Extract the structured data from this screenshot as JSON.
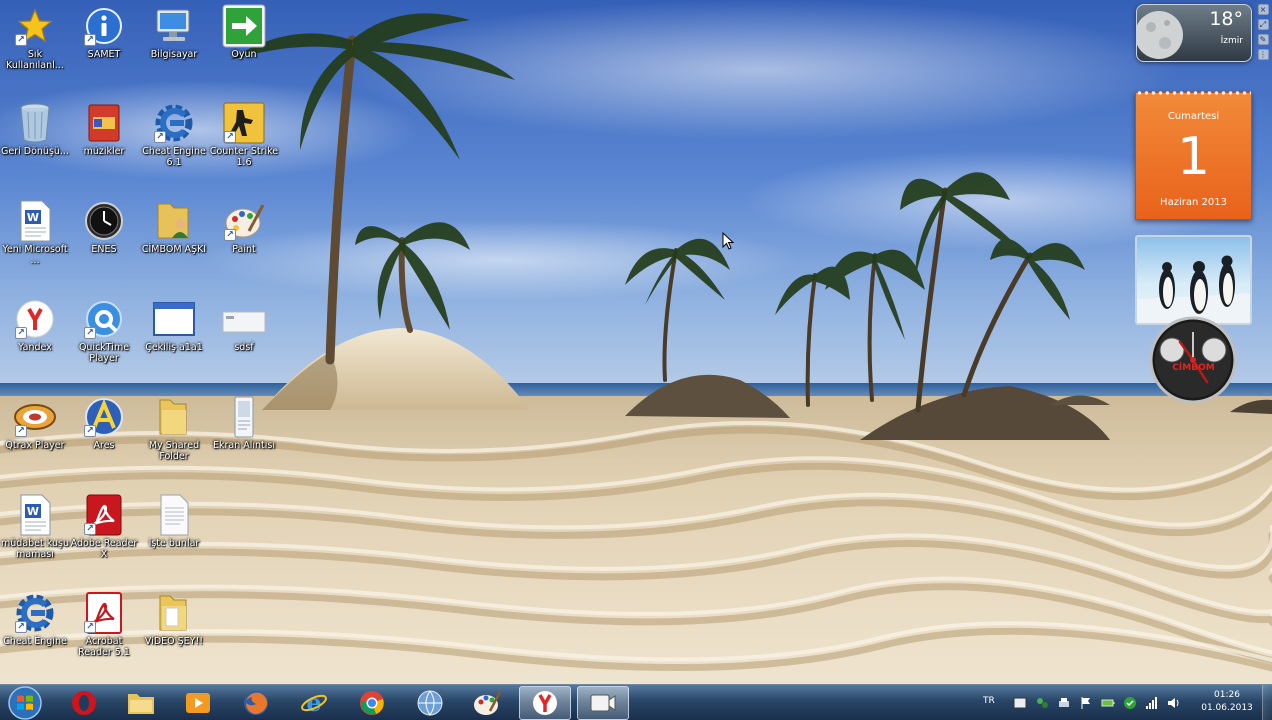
{
  "desktop": {
    "icons": [
      {
        "label": "Sık Kullanılanl...",
        "icon": "star-icon",
        "shortcut": true
      },
      {
        "label": "SAMET",
        "icon": "info-icon",
        "shortcut": true
      },
      {
        "label": "Bilgisayar",
        "icon": "computer-icon",
        "shortcut": false
      },
      {
        "label": "Oyun",
        "icon": "green-arrow-icon",
        "shortcut": false
      },
      {
        "label": "Geri Dönüşü...",
        "icon": "recycle-bin-icon",
        "shortcut": false
      },
      {
        "label": "müzikler",
        "icon": "music-folder-icon",
        "shortcut": false
      },
      {
        "label": "Cheat Engine 6.1",
        "icon": "cheat-engine-icon",
        "shortcut": true
      },
      {
        "label": "Counter Strike 1.6",
        "icon": "counter-strike-icon",
        "shortcut": true
      },
      {
        "label": "Yeni Microsoft ...",
        "icon": "word-document-icon",
        "shortcut": false
      },
      {
        "label": "ENES",
        "icon": "clock-app-icon",
        "shortcut": false
      },
      {
        "label": "CİMBOM AŞKI",
        "icon": "user-folder-icon",
        "shortcut": false
      },
      {
        "label": "Paint",
        "icon": "paint-icon",
        "shortcut": true
      },
      {
        "label": "Yandex",
        "icon": "yandex-icon",
        "shortcut": true
      },
      {
        "label": "QuickTime Player",
        "icon": "quicktime-icon",
        "shortcut": true
      },
      {
        "label": "Çekiliş a1a1",
        "icon": "window-icon",
        "shortcut": false
      },
      {
        "label": "sdsf",
        "icon": "blank-window-icon",
        "shortcut": false
      },
      {
        "label": "Qtrax Player",
        "icon": "qtrax-icon",
        "shortcut": true
      },
      {
        "label": "Ares",
        "icon": "ares-icon",
        "shortcut": true
      },
      {
        "label": "My Shared Folder",
        "icon": "folder-icon",
        "shortcut": false
      },
      {
        "label": "Ekran Alıntısı",
        "icon": "snipping-tool-icon",
        "shortcut": false
      },
      {
        "label": "müdabet kuşu maması",
        "icon": "word-document-icon",
        "shortcut": false
      },
      {
        "label": "Adobe Reader X",
        "icon": "adobe-reader-icon",
        "shortcut": true
      },
      {
        "label": "işte bunlar",
        "icon": "text-document-icon",
        "shortcut": false
      },
      {
        "label": "Cheat Engine",
        "icon": "cheat-engine-icon",
        "shortcut": true
      },
      {
        "label": "Acrobat Reader 5.1",
        "icon": "acrobat-icon",
        "shortcut": true
      },
      {
        "label": "ViDEO ŞEY!!",
        "icon": "folder-icon",
        "shortcut": false
      }
    ]
  },
  "gadgets": {
    "weather": {
      "temperature": "18°",
      "city": "İzmir"
    },
    "calendar": {
      "weekday": "Cumartesi",
      "day": "1",
      "month_year": "Haziran 2013"
    },
    "clock": {
      "brand": "CİMBOM"
    }
  },
  "taskbar": {
    "pinned": [
      {
        "name": "opera",
        "icon": "opera-icon",
        "active": false
      },
      {
        "name": "explorer",
        "icon": "folder-explorer-icon",
        "active": false
      },
      {
        "name": "media-player",
        "icon": "media-player-icon",
        "active": false
      },
      {
        "name": "firefox",
        "icon": "firefox-icon",
        "active": false
      },
      {
        "name": "internet-explorer",
        "icon": "internet-explorer-icon",
        "active": false
      },
      {
        "name": "chrome",
        "icon": "chrome-icon",
        "active": false
      },
      {
        "name": "network-app",
        "icon": "globe-icon",
        "active": false
      },
      {
        "name": "paint",
        "icon": "paint-icon",
        "active": false
      },
      {
        "name": "yandex",
        "icon": "yandex-icon",
        "active": true
      },
      {
        "name": "video-recorder",
        "icon": "video-recorder-icon",
        "active": true
      }
    ],
    "tray": {
      "language": "TR",
      "time": "01:26",
      "date": "01.06.2013"
    }
  },
  "colors": {
    "calendar_orange": "#e8621b",
    "taskbar_blue": "#1e3c5f",
    "sky_blue": "#3f6fc4",
    "sand": "#e6d6b6"
  }
}
